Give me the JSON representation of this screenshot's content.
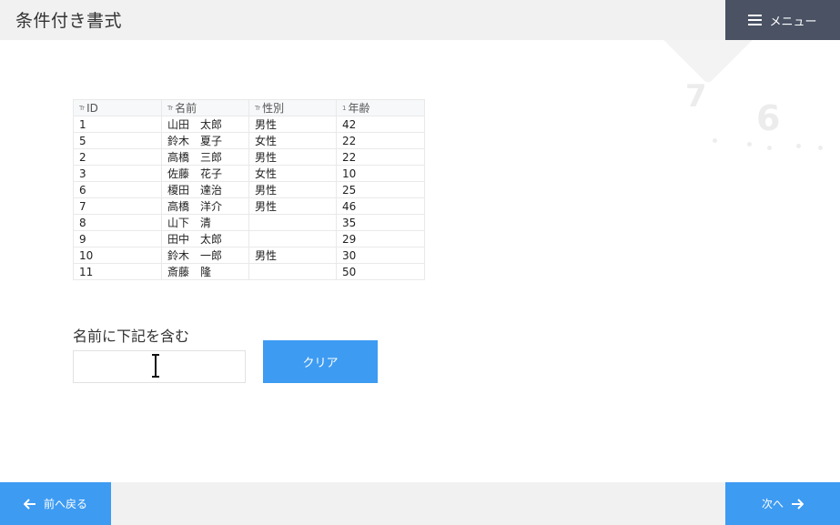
{
  "header": {
    "title": "条件付き書式",
    "menu_label": "メニュー"
  },
  "table": {
    "columns": [
      {
        "icon": "Tr",
        "label": "ID"
      },
      {
        "icon": "Tr",
        "label": "名前"
      },
      {
        "icon": "Tr",
        "label": "性別"
      },
      {
        "icon": "1",
        "label": "年齢"
      }
    ],
    "rows": [
      [
        "1",
        "山田　太郎",
        "男性",
        "42"
      ],
      [
        "5",
        "鈴木　夏子",
        "女性",
        "22"
      ],
      [
        "2",
        "高橋　三郎",
        "男性",
        "22"
      ],
      [
        "3",
        "佐藤　花子",
        "女性",
        "10"
      ],
      [
        "6",
        "榎田　達治",
        "男性",
        "25"
      ],
      [
        "7",
        "高橋　洋介",
        "男性",
        "46"
      ],
      [
        "8",
        "山下　清",
        "",
        "35"
      ],
      [
        "9",
        "田中　太郎",
        "",
        "29"
      ],
      [
        "10",
        "鈴木　一郎",
        "男性",
        "30"
      ],
      [
        "11",
        "斎藤　隆",
        "",
        "50"
      ]
    ]
  },
  "filter": {
    "label": "名前に下記を含む",
    "value": "",
    "placeholder": "",
    "clear_label": "クリア"
  },
  "footer": {
    "prev_label": "前へ戻る",
    "next_label": "次へ"
  },
  "background": {
    "digit_a": "7",
    "digit_b": "6"
  },
  "colors": {
    "accent": "#3d9bf2",
    "menu_bg": "#4a5264",
    "bar_bg": "#f1f1f1"
  }
}
